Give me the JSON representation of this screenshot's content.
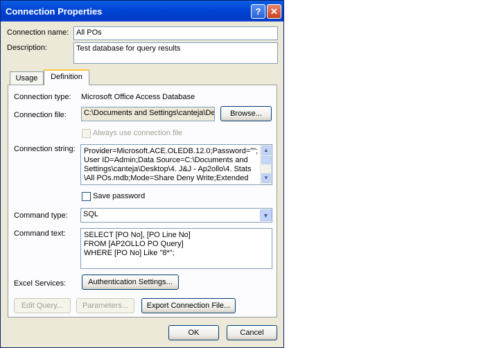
{
  "window": {
    "title": "Connection Properties"
  },
  "labels": {
    "connection_name": "Connection name:",
    "description": "Description:",
    "connection_type": "Connection type:",
    "connection_file": "Connection file:",
    "connection_string": "Connection string:",
    "command_type": "Command type:",
    "command_text": "Command text:",
    "excel_services": "Excel Services:"
  },
  "values": {
    "connection_name": "All POs",
    "description": "Test database for query results",
    "connection_type": "Microsoft Office Access Database",
    "connection_file": "C:\\Documents and Settings\\canteja\\De",
    "connection_string": "Provider=Microsoft.ACE.OLEDB.12.0;Password=\"\";\nUser ID=Admin;Data Source=C:\\Documents and\nSettings\\canteja\\Desktop\\4. J&J - Ap2ollo\\4. Stats\n\\All POs.mdb;Mode=Share Deny Write;Extended",
    "command_type": "SQL",
    "command_text": "SELECT [PO No], [PO Line No]\nFROM [AP2OLLO PO Query]\nWHERE [PO No] Like \"8*\";"
  },
  "tabs": {
    "usage": "Usage",
    "definition": "Definition"
  },
  "checkboxes": {
    "always_use_file": "Always use connection file",
    "save_password": "Save password"
  },
  "buttons": {
    "help": "?",
    "close": "✕",
    "browse": "Browse...",
    "authentication": "Authentication Settings...",
    "edit_query": "Edit Query...",
    "parameters": "Parameters...",
    "export": "Export Connection File...",
    "ok": "OK",
    "cancel": "Cancel"
  },
  "icons": {
    "scroll_up": "▲",
    "scroll_down": "▼",
    "dropdown": "▼"
  }
}
